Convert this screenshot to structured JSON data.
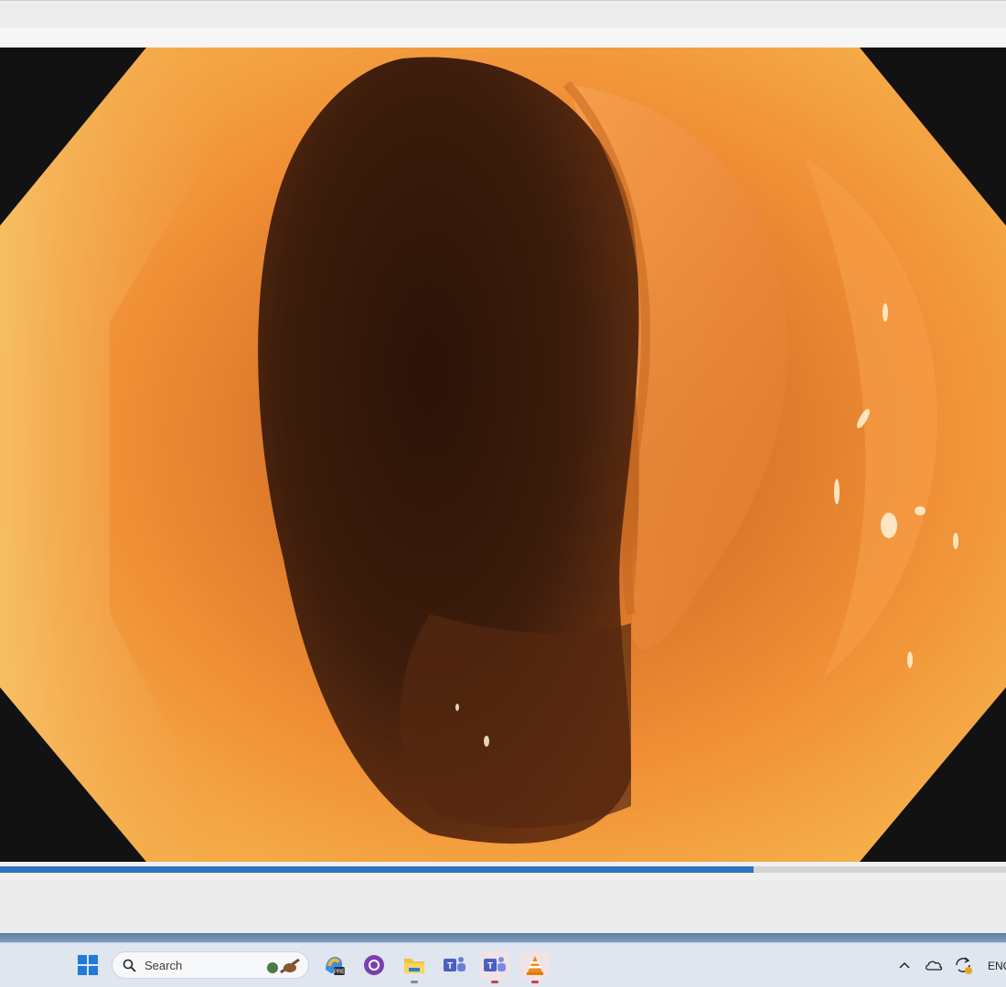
{
  "video": {
    "description_icon": "endoscopy-frame",
    "progress": 0.749
  },
  "colors": {
    "accent": "#2d73c2",
    "tissue": "#e8822f",
    "lumen": "#3b1c0c"
  },
  "taskbar": {
    "search_label": "Search",
    "language": "ENG",
    "icons": [
      "windows-start-icon",
      "search-icon",
      "copilot-icon",
      "github-icon",
      "file-explorer-icon",
      "teams-icon",
      "teams-work-icon",
      "vlc-icon",
      "chevron-up-icon",
      "onedrive-icon",
      "sync-icon"
    ]
  }
}
